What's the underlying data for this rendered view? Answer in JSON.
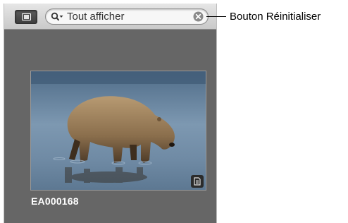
{
  "toolbar": {
    "view_toggle_icon": "browser-view-icon",
    "search": {
      "value": "Tout afficher",
      "search_icon": "magnifier-dropdown-icon",
      "reset_icon": "clear-circle-x-icon"
    }
  },
  "browser": {
    "items": [
      {
        "caption": "EA000168",
        "image_subject": "brown bear walking in shallow water",
        "badge_icon": "referenced-file-icon"
      }
    ]
  },
  "annotation": {
    "label": "Bouton Réinitialiser"
  },
  "colors": {
    "panel_bg": "#666666",
    "toolbar_bg": "#d6d6d6",
    "caption": "#ffffff"
  }
}
